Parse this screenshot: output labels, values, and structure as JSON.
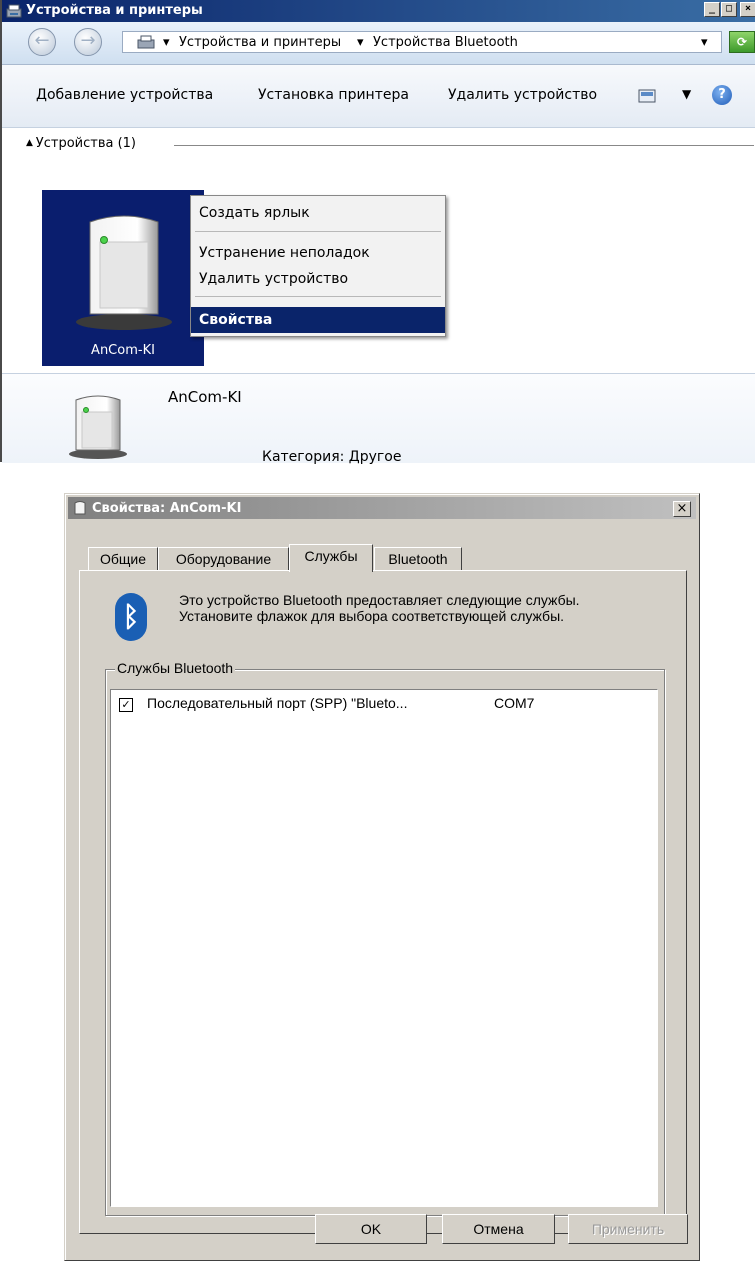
{
  "explorer": {
    "title": "Устройства и принтеры",
    "window_controls": [
      "_",
      "□",
      "×"
    ],
    "breadcrumb": [
      "Устройства и принтеры",
      "Устройства Bluetooth"
    ],
    "toolbar": {
      "add_device": "Добавление устройства",
      "install_printer": "Установка принтера",
      "remove_device": "Удалить устройство"
    },
    "group_header": "Устройства (1)",
    "device": {
      "name": "AnCom-KI"
    },
    "context_menu": {
      "create_shortcut": "Создать ярлык",
      "troubleshoot": "Устранение неполадок",
      "remove_device": "Удалить устройство",
      "properties": "Свойства"
    },
    "details": {
      "name": "AnCom-KI",
      "category": "Категория: Другое"
    }
  },
  "dialog": {
    "title": "Свойства: AnCom-KI",
    "close_glyph": "×",
    "tabs": [
      "Общие",
      "Оборудование",
      "Службы",
      "Bluetooth"
    ],
    "active_tab": "Службы",
    "description": "Это устройство Bluetooth предоставляет следующие службы. Установите флажок для выбора соответствующей службы.",
    "group_label": "Службы Bluetooth",
    "services": [
      {
        "name": "Последовательный порт (SPP) \"Blueto...",
        "port": "COM7",
        "checked": true
      }
    ],
    "buttons": {
      "ok": "OK",
      "cancel": "Отмена",
      "apply": "Применить"
    }
  },
  "colors": {
    "title_active": "#0a246a",
    "selection": "#0a1e6e",
    "dialog_face": "#d4d0c8",
    "bluetooth": "#1a5fb4"
  }
}
